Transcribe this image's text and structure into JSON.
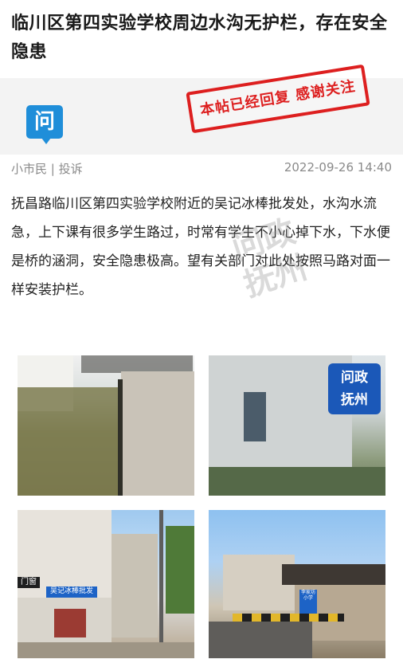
{
  "post": {
    "title": "临川区第四实验学校周边水沟无护栏，存在安全隐患",
    "badge_glyph": "问",
    "stamp_text": "本帖已经回复 感谢关注",
    "author": "小市民",
    "category": "投诉",
    "meta_separator": " | ",
    "datetime": "2022-09-26 14:40",
    "body": "抚昌路临川区第四实验学校附近的吴记冰棒批发处，水沟水流急，上下课有很多学生路过，时常有学生不小心掉下水，下水便是桥的涵洞，安全隐患极高。望有关部门对此处按照马路对面一样安装护栏。",
    "watermark": "问政抚州"
  },
  "photos": [
    {
      "name": "ditch-photo-1",
      "caption": ""
    },
    {
      "name": "ditch-photo-2",
      "logo_line1": "问政",
      "logo_line2": "抚州"
    },
    {
      "name": "street-photo-3",
      "shop_sign": "门窗",
      "store_sign": "吴记冰棒批发"
    },
    {
      "name": "street-photo-4",
      "road_sign": "李家坊小学"
    }
  ],
  "colors": {
    "accent_blue": "#1f8ed9",
    "stamp_red": "#dd1f1f",
    "meta_gray": "#8a8a8a"
  }
}
